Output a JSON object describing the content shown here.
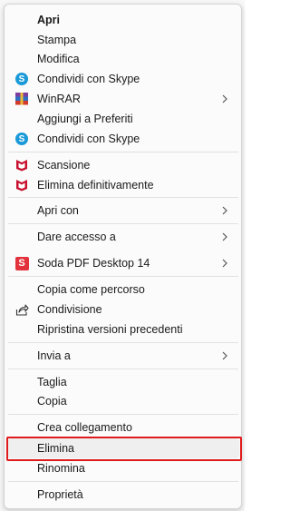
{
  "menu": {
    "items": [
      {
        "label": "Apri",
        "icon": "none",
        "submenu": false,
        "bold": true
      },
      {
        "label": "Stampa",
        "icon": "none",
        "submenu": false
      },
      {
        "label": "Modifica",
        "icon": "none",
        "submenu": false
      },
      {
        "label": "Condividi con Skype",
        "icon": "skype-icon",
        "submenu": false
      },
      {
        "label": "WinRAR",
        "icon": "winrar-icon",
        "submenu": true
      },
      {
        "label": "Aggiungi a Preferiti",
        "icon": "none",
        "submenu": false
      },
      {
        "label": "Condividi con Skype",
        "icon": "skype-icon",
        "submenu": false
      },
      {
        "label": "Scansione",
        "icon": "mcafee-icon",
        "submenu": false
      },
      {
        "label": "Elimina definitivamente",
        "icon": "mcafee-icon",
        "submenu": false
      },
      {
        "label": "Apri con",
        "icon": "none",
        "submenu": true
      },
      {
        "label": "Dare accesso a",
        "icon": "none",
        "submenu": true
      },
      {
        "label": "Soda PDF Desktop 14",
        "icon": "soda-pdf-icon",
        "submenu": true
      },
      {
        "label": "Copia come percorso",
        "icon": "none",
        "submenu": false
      },
      {
        "label": "Condivisione",
        "icon": "share-icon",
        "submenu": false
      },
      {
        "label": "Ripristina versioni precedenti",
        "icon": "none",
        "submenu": false
      },
      {
        "label": "Invia a",
        "icon": "none",
        "submenu": true
      },
      {
        "label": "Taglia",
        "icon": "none",
        "submenu": false
      },
      {
        "label": "Copia",
        "icon": "none",
        "submenu": false
      },
      {
        "label": "Crea collegamento",
        "icon": "none",
        "submenu": false
      },
      {
        "label": "Elimina",
        "icon": "none",
        "submenu": false,
        "highlighted": true
      },
      {
        "label": "Rinomina",
        "icon": "none",
        "submenu": false
      },
      {
        "label": "Proprietà",
        "icon": "none",
        "submenu": false
      }
    ]
  },
  "colors": {
    "highlight_border": "#e01b1b",
    "skype": "#1a9ad8",
    "mcafee": "#c8102e",
    "soda_pdf": "#e2323b"
  }
}
